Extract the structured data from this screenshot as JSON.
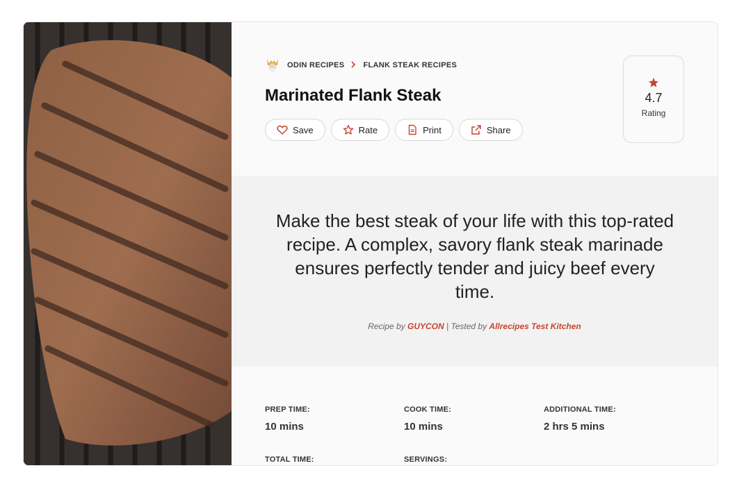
{
  "breadcrumb": {
    "items": [
      "ODIN RECIPES",
      "FLANK STEAK RECIPES"
    ]
  },
  "recipe": {
    "title": "Marinated Flank Steak",
    "description": "Make the best steak of your life with this top-rated recipe. A complex, savory flank steak marinade ensures perfectly tender and juicy beef every time.",
    "byline": {
      "recipe_by_prefix": "Recipe by",
      "author": "GUYCON",
      "tested_by_prefix": "| Tested by",
      "tester": "Allrecipes Test Kitchen"
    }
  },
  "actions": {
    "save": "Save",
    "rate": "Rate",
    "print": "Print",
    "share": "Share"
  },
  "rating": {
    "value": "4.7",
    "label": "Rating"
  },
  "times": {
    "prep_label": "PREP TIME:",
    "prep_value": "10 mins",
    "cook_label": "COOK TIME:",
    "cook_value": "10 mins",
    "additional_label": "ADDITIONAL TIME:",
    "additional_value": "2 hrs 5 mins",
    "total_label": "TOTAL TIME:",
    "servings_label": "SERVINGS:"
  },
  "colors": {
    "accent": "#c8452f",
    "band": "#f2f2f2"
  }
}
